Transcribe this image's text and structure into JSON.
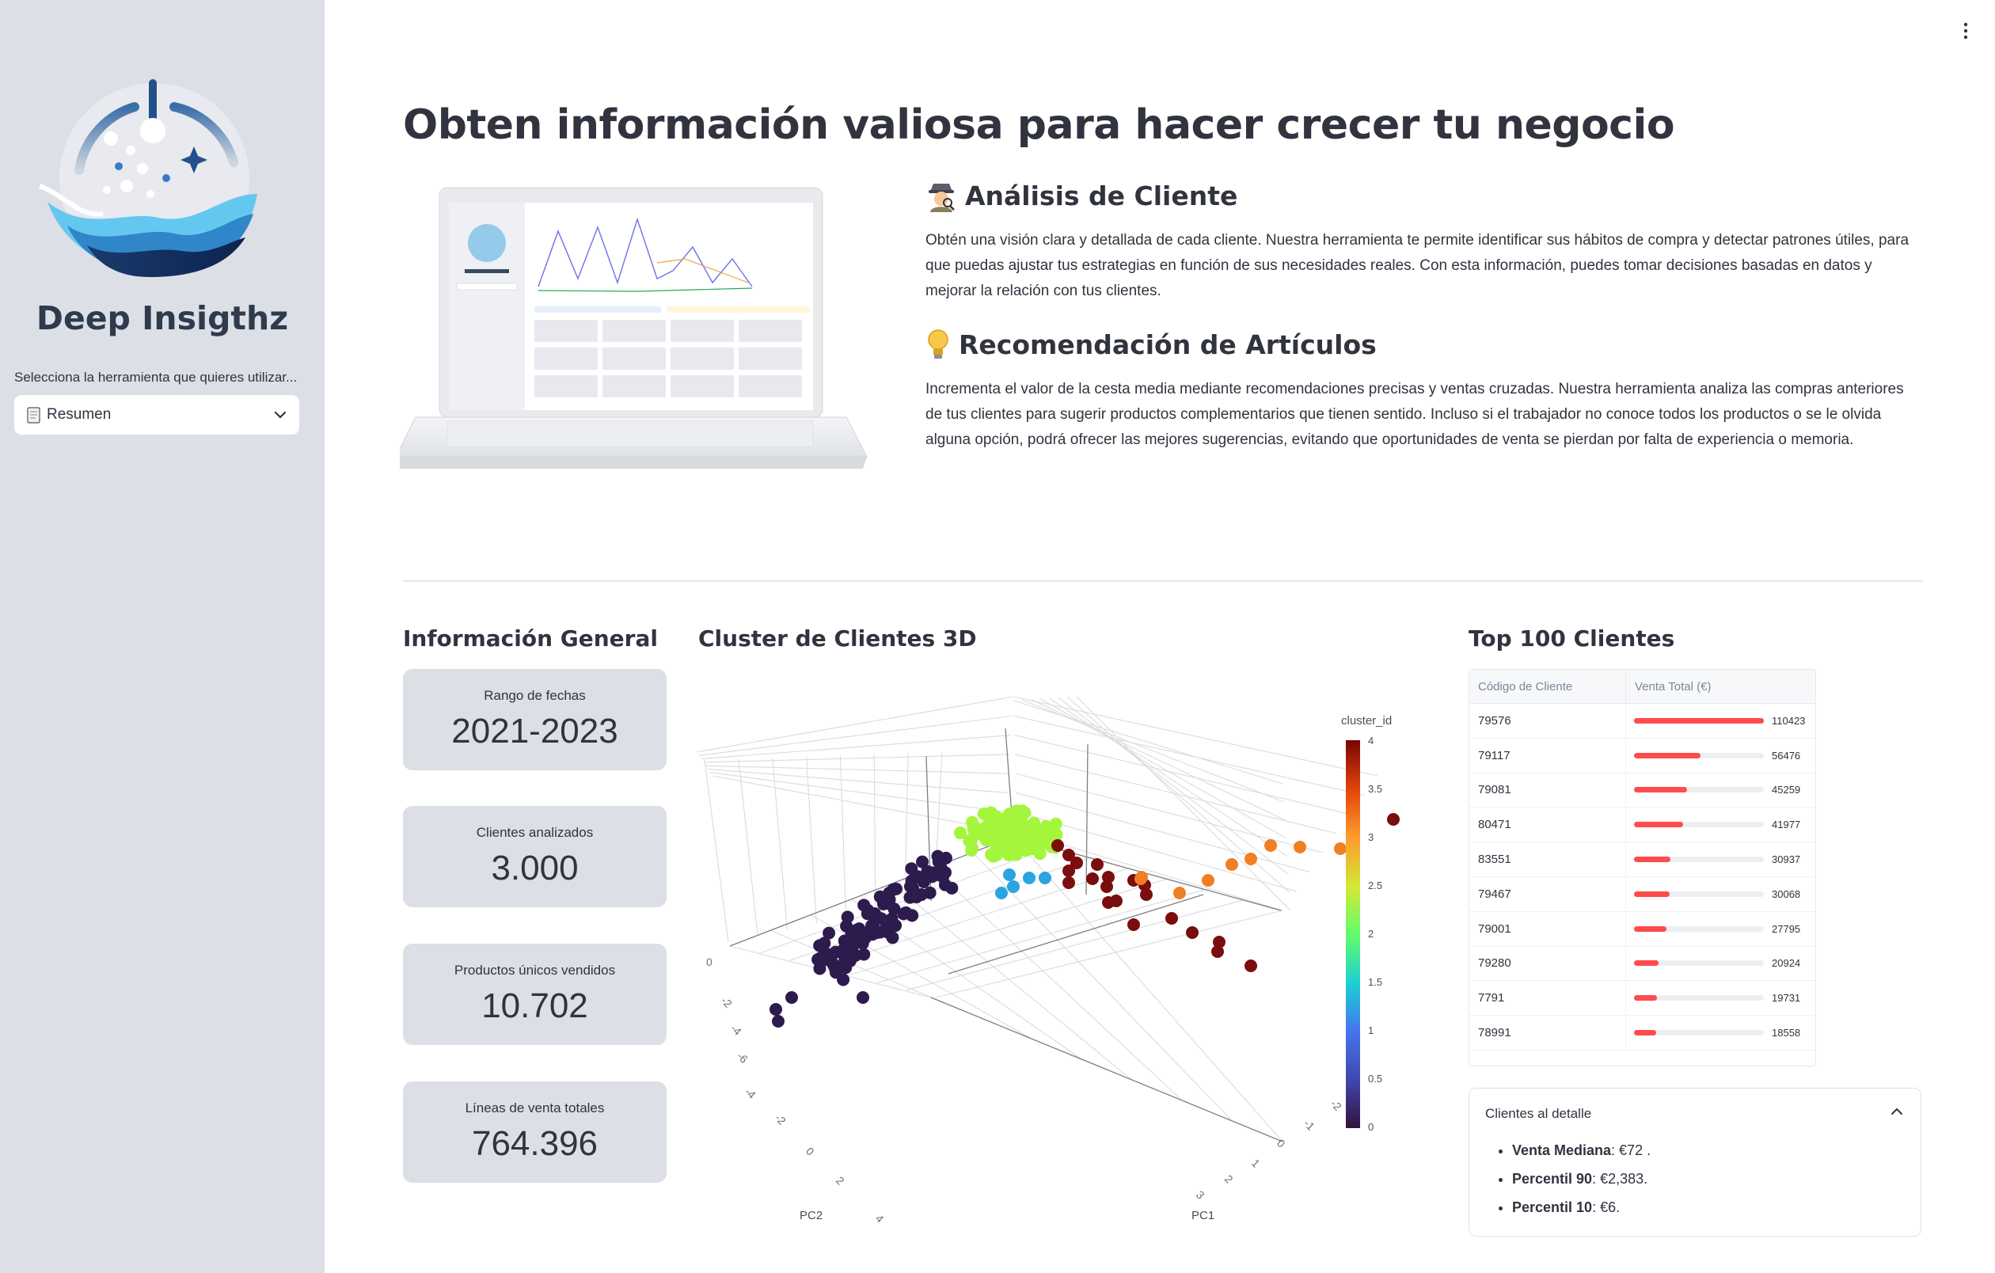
{
  "sidebar": {
    "brand": "Deep Insigthz",
    "select_label": "Selecciona la herramienta que quieres utilizar...",
    "select_value": "Resumen"
  },
  "main": {
    "title": "Obten información valiosa para hacer crecer tu negocio",
    "sections": [
      {
        "title": "Análisis de Cliente",
        "icon": "detective-emoji",
        "text": "Obtén una visión clara y detallada de cada cliente. Nuestra herramienta te permite identificar sus hábitos de compra y detectar patrones útiles, para que puedas ajustar tus estrategias en función de sus necesidades reales. Con esta información, puedes tomar decisiones basadas en datos y mejorar la relación con tus clientes."
      },
      {
        "title": "Recomendación de Artículos",
        "icon": "lightbulb-emoji",
        "text": "Incrementa el valor de la cesta media mediante recomendaciones precisas y ventas cruzadas. Nuestra herramienta analiza las compras anteriores de tus clientes para sugerir productos complementarios que tienen sentido. Incluso si el trabajador no conoce todos los productos o se le olvida alguna opción, podrá ofrecer las mejores sugerencias, evitando que oportunidades de venta se pierdan por falta de experiencia o memoria."
      }
    ]
  },
  "general_info": {
    "title": "Información General",
    "metrics": [
      {
        "label": "Rango de fechas",
        "value": "2021-2023"
      },
      {
        "label": "Clientes analizados",
        "value": "3.000"
      },
      {
        "label": "Productos únicos vendidos",
        "value": "10.702"
      },
      {
        "label": "Líneas de venta totales",
        "value": "764.396"
      }
    ]
  },
  "cluster": {
    "title": "Cluster de Clientes 3D",
    "colorbar_title": "cluster_id",
    "colorbar_ticks": [
      "4",
      "3.5",
      "3",
      "2.5",
      "2",
      "1.5",
      "1",
      "0.5",
      "0"
    ],
    "axis_pc1": "PC1",
    "axis_pc2": "PC2",
    "pc2_ticks": [
      "0",
      "-2",
      "-4",
      "-6",
      "-4",
      "-2",
      "0",
      "2",
      "4"
    ],
    "pc1_ticks": [
      "-2",
      "-1",
      "0",
      "1",
      "2",
      "3"
    ],
    "z_ticks": [
      "0"
    ]
  },
  "top_clients": {
    "title": "Top 100 Clientes",
    "col_code": "Código de Cliente",
    "col_sales": "Venta Total (€)",
    "max": 110423,
    "rows": [
      {
        "code": "79576",
        "sales": "110423",
        "value": 110423
      },
      {
        "code": "79117",
        "sales": "56476",
        "value": 56476
      },
      {
        "code": "79081",
        "sales": "45259",
        "value": 45259
      },
      {
        "code": "80471",
        "sales": "41977",
        "value": 41977
      },
      {
        "code": "83551",
        "sales": "30937",
        "value": 30937
      },
      {
        "code": "79467",
        "sales": "30068",
        "value": 30068
      },
      {
        "code": "79001",
        "sales": "27795",
        "value": 27795
      },
      {
        "code": "79280",
        "sales": "20924",
        "value": 20924
      },
      {
        "code": "7791",
        "sales": "19731",
        "value": 19731
      },
      {
        "code": "78991",
        "sales": "18558",
        "value": 18558
      }
    ]
  },
  "detail": {
    "title": "Clientes al detalle",
    "items": [
      {
        "label": "Venta Mediana",
        "value": ": €72 ."
      },
      {
        "label": "Percentil 90",
        "value": ": €2,383."
      },
      {
        "label": "Percentil 10",
        "value": ": €6."
      }
    ]
  },
  "colors": {
    "accent": "#ff4b4b",
    "sidebar_bg": "#dcdfe6",
    "metric_bg": "#dcdfe6",
    "text": "#31333f"
  }
}
